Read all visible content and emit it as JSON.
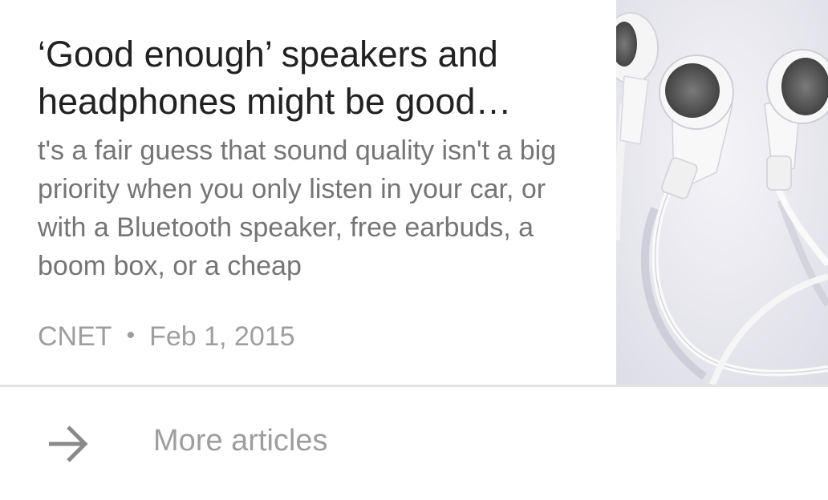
{
  "article": {
    "headline": "‘Good enough’ speakers and headphones might be good…",
    "snippet": "t's a fair guess that sound quality isn't a big priority when you only listen in your car, or with a Bluetooth speaker, free earbuds, a boom box, or a cheap",
    "source": "CNET",
    "separator": "•",
    "date": "Feb 1, 2015",
    "thumbnail_icon": "earbuds-photo"
  },
  "footer": {
    "more_label": "More articles",
    "arrow_icon": "arrow-right-icon"
  }
}
